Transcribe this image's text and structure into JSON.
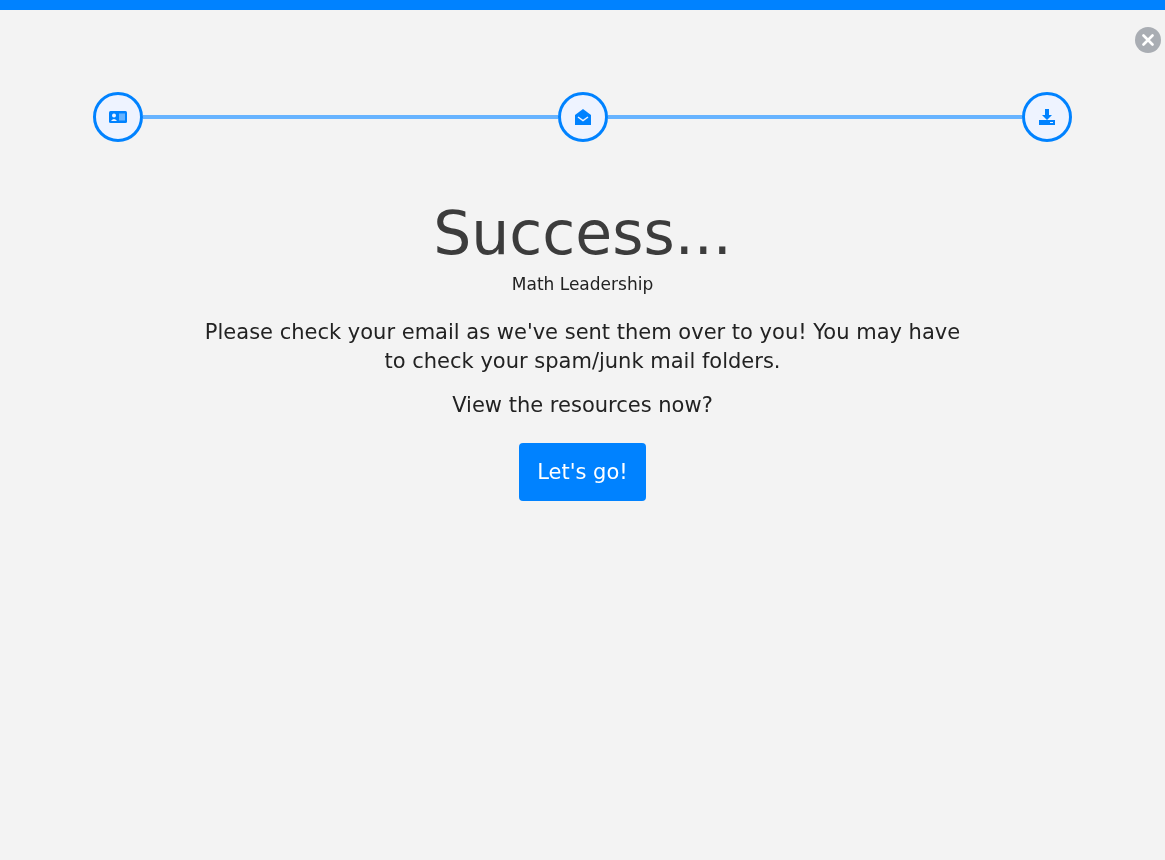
{
  "steps": [
    {
      "kind": "contact"
    },
    {
      "kind": "envelope"
    },
    {
      "kind": "download"
    }
  ],
  "title": "Success...",
  "subtitle": "Math Leadership",
  "message": "Please check your email as we've sent them over to you! You may have to check your spam/junk mail folders.",
  "prompt": "View the resources now?",
  "button": "Let's go!"
}
